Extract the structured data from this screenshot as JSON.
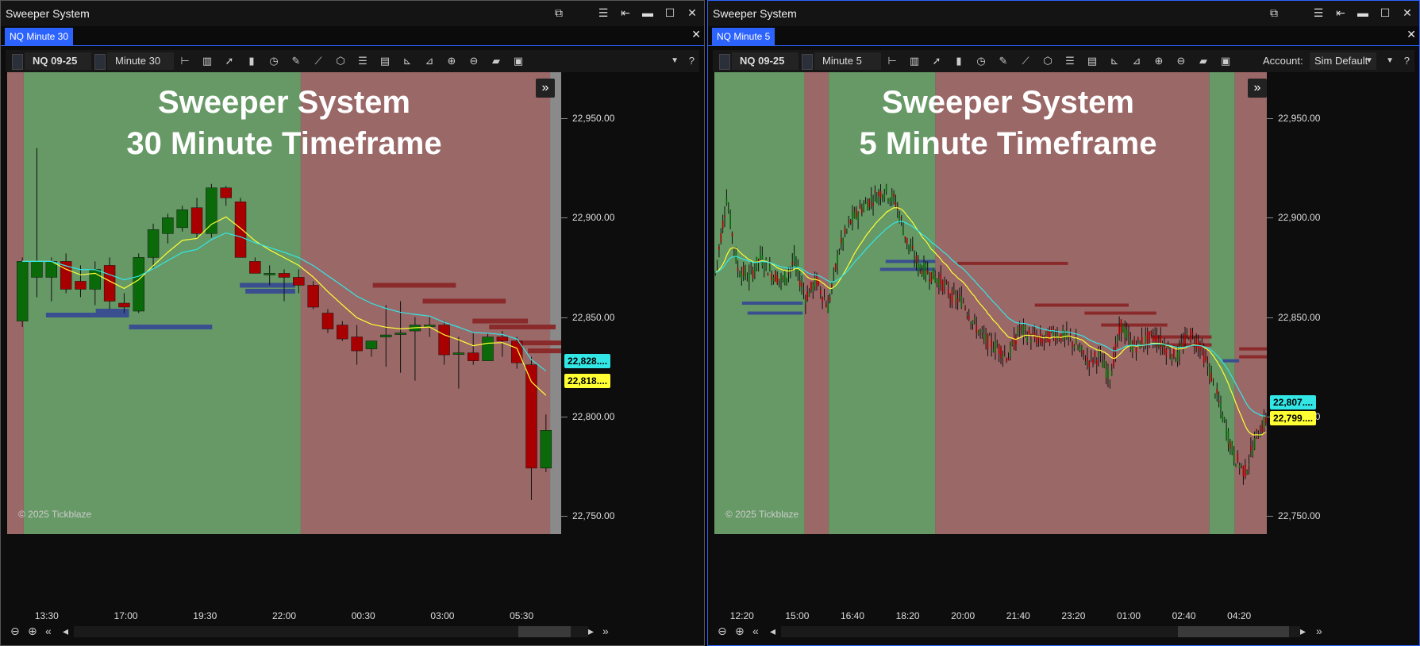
{
  "left": {
    "window_title": "Sweeper System",
    "tab_label": "NQ Minute 30",
    "instrument": "NQ 09-25",
    "interval": "Minute 30",
    "overlay_line1": "Sweeper System",
    "overlay_line2": "30 Minute Timeframe",
    "copyright": "© 2025 Tickblaze",
    "price_labels": [
      "22,950.00",
      "22,900.00",
      "22,850.00",
      "22,800.00",
      "22,750.00"
    ],
    "badge_cyan": "22,828....",
    "badge_yellow": "22,818....",
    "time_labels": [
      "13:30",
      "17:00",
      "19:30",
      "22:00",
      "00:30",
      "03:00",
      "05:30"
    ]
  },
  "right": {
    "window_title": "Sweeper System",
    "tab_label": "NQ Minute 5",
    "instrument": "NQ 09-25",
    "interval": "Minute 5",
    "account_label": "Account:",
    "account_value": "Sim Default",
    "overlay_line1": "Sweeper System",
    "overlay_line2": "5 Minute Timeframe",
    "copyright": "© 2025 Tickblaze",
    "price_labels": [
      "22,950.00",
      "22,900.00",
      "22,850.00",
      "22,800.00",
      "22,750.00"
    ],
    "badge_cyan": "22,807....",
    "badge_yellow": "22,799....",
    "time_labels": [
      "12:20",
      "15:00",
      "16:40",
      "18:20",
      "20:00",
      "21:40",
      "23:20",
      "01:00",
      "02:40",
      "04:20"
    ]
  },
  "colors": {
    "bull_zone": "#669966",
    "bear_zone": "#9b6868",
    "gray_zone": "#8a8a8a",
    "bull_candle": "#0a6a0a",
    "bear_candle": "#a80000",
    "ema_fast": "#ffff33",
    "ema_slow": "#33e6e6",
    "support_line": "#3a4f8f",
    "resistance_line": "#8a2a2a",
    "accent": "#2c63ff"
  },
  "icons": {
    "toolbar": [
      "bar-type-icon",
      "chart-style-icon",
      "cursor-icon",
      "candles-icon",
      "clock-icon",
      "pencil-icon",
      "line-tool-icon",
      "cube-icon",
      "list-icon",
      "template-icon",
      "axis-icon",
      "measure-icon",
      "zoom-in-icon",
      "zoom-out-icon",
      "folder-icon",
      "save-icon"
    ]
  },
  "chart_data": [
    {
      "type": "candlestick",
      "title": "Sweeper System 30 Minute Timeframe",
      "instrument": "NQ 09-25",
      "interval": "Minute 30",
      "ylim": [
        22740,
        22970
      ],
      "time_labels": [
        "13:30",
        "17:00",
        "19:30",
        "22:00",
        "00:30",
        "03:00",
        "05:30"
      ],
      "last_price_fast_ema": 22828,
      "last_price_slow_ema": 22818,
      "candles": [
        {
          "o": 22848,
          "h": 22880,
          "l": 22845,
          "c": 22878
        },
        {
          "o": 22870,
          "h": 22935,
          "l": 22860,
          "c": 22878
        },
        {
          "o": 22870,
          "h": 22880,
          "l": 22858,
          "c": 22878
        },
        {
          "o": 22878,
          "h": 22882,
          "l": 22862,
          "c": 22864
        },
        {
          "o": 22868,
          "h": 22876,
          "l": 22860,
          "c": 22864
        },
        {
          "o": 22864,
          "h": 22878,
          "l": 22856,
          "c": 22874
        },
        {
          "o": 22876,
          "h": 22880,
          "l": 22854,
          "c": 22858
        },
        {
          "o": 22857,
          "h": 22862,
          "l": 22852,
          "c": 22855
        },
        {
          "o": 22853,
          "h": 22882,
          "l": 22852,
          "c": 22880
        },
        {
          "o": 22880,
          "h": 22897,
          "l": 22874,
          "c": 22894
        },
        {
          "o": 22892,
          "h": 22902,
          "l": 22887,
          "c": 22900
        },
        {
          "o": 22895,
          "h": 22906,
          "l": 22893,
          "c": 22904
        },
        {
          "o": 22905,
          "h": 22910,
          "l": 22890,
          "c": 22892
        },
        {
          "o": 22892,
          "h": 22917,
          "l": 22890,
          "c": 22915
        },
        {
          "o": 22915,
          "h": 22916,
          "l": 22906,
          "c": 22910
        },
        {
          "o": 22908,
          "h": 22910,
          "l": 22880,
          "c": 22880
        },
        {
          "o": 22878,
          "h": 22880,
          "l": 22872,
          "c": 22872
        },
        {
          "o": 22872,
          "h": 22876,
          "l": 22866,
          "c": 22872
        },
        {
          "o": 22872,
          "h": 22874,
          "l": 22858,
          "c": 22870
        },
        {
          "o": 22870,
          "h": 22874,
          "l": 22862,
          "c": 22866
        },
        {
          "o": 22866,
          "h": 22868,
          "l": 22854,
          "c": 22855
        },
        {
          "o": 22852,
          "h": 22854,
          "l": 22842,
          "c": 22844
        },
        {
          "o": 22846,
          "h": 22848,
          "l": 22838,
          "c": 22839
        },
        {
          "o": 22840,
          "h": 22846,
          "l": 22826,
          "c": 22833
        },
        {
          "o": 22834,
          "h": 22838,
          "l": 22830,
          "c": 22838
        },
        {
          "o": 22840,
          "h": 22856,
          "l": 22825,
          "c": 22841
        },
        {
          "o": 22842,
          "h": 22858,
          "l": 22822,
          "c": 22842
        },
        {
          "o": 22843,
          "h": 22850,
          "l": 22818,
          "c": 22846
        },
        {
          "o": 22846,
          "h": 22850,
          "l": 22840,
          "c": 22846
        },
        {
          "o": 22846,
          "h": 22848,
          "l": 22826,
          "c": 22831
        },
        {
          "o": 22832,
          "h": 22840,
          "l": 22814,
          "c": 22832
        },
        {
          "o": 22832,
          "h": 22842,
          "l": 22826,
          "c": 22828
        },
        {
          "o": 22828,
          "h": 22842,
          "l": 22828,
          "c": 22840
        },
        {
          "o": 22840,
          "h": 22843,
          "l": 22830,
          "c": 22838
        },
        {
          "o": 22838,
          "h": 22840,
          "l": 22824,
          "c": 22827
        },
        {
          "o": 22826,
          "h": 22830,
          "l": 22758,
          "c": 22774
        },
        {
          "o": 22774,
          "h": 22801,
          "l": 22772,
          "c": 22793
        }
      ]
    },
    {
      "type": "candlestick",
      "title": "Sweeper System 5 Minute Timeframe",
      "instrument": "NQ 09-25",
      "interval": "Minute 5",
      "ylim": [
        22740,
        22970
      ],
      "time_labels": [
        "12:20",
        "15:00",
        "16:40",
        "18:20",
        "20:00",
        "21:40",
        "23:20",
        "01:00",
        "02:40",
        "04:20"
      ],
      "last_price_fast_ema": 22807,
      "last_price_slow_ema": 22799,
      "price_path": [
        22872,
        22910,
        22874,
        22870,
        22880,
        22872,
        22868,
        22878,
        22860,
        22868,
        22855,
        22884,
        22898,
        22905,
        22910,
        22914,
        22908,
        22888,
        22876,
        22872,
        22868,
        22860,
        22858,
        22846,
        22838,
        22835,
        22830,
        22844,
        22840,
        22838,
        22842,
        22840,
        22836,
        22828,
        22830,
        22820,
        22846,
        22835,
        22838,
        22840,
        22834,
        22830,
        22842,
        22836,
        22820,
        22800,
        22780,
        22772,
        22790,
        22800
      ]
    }
  ]
}
